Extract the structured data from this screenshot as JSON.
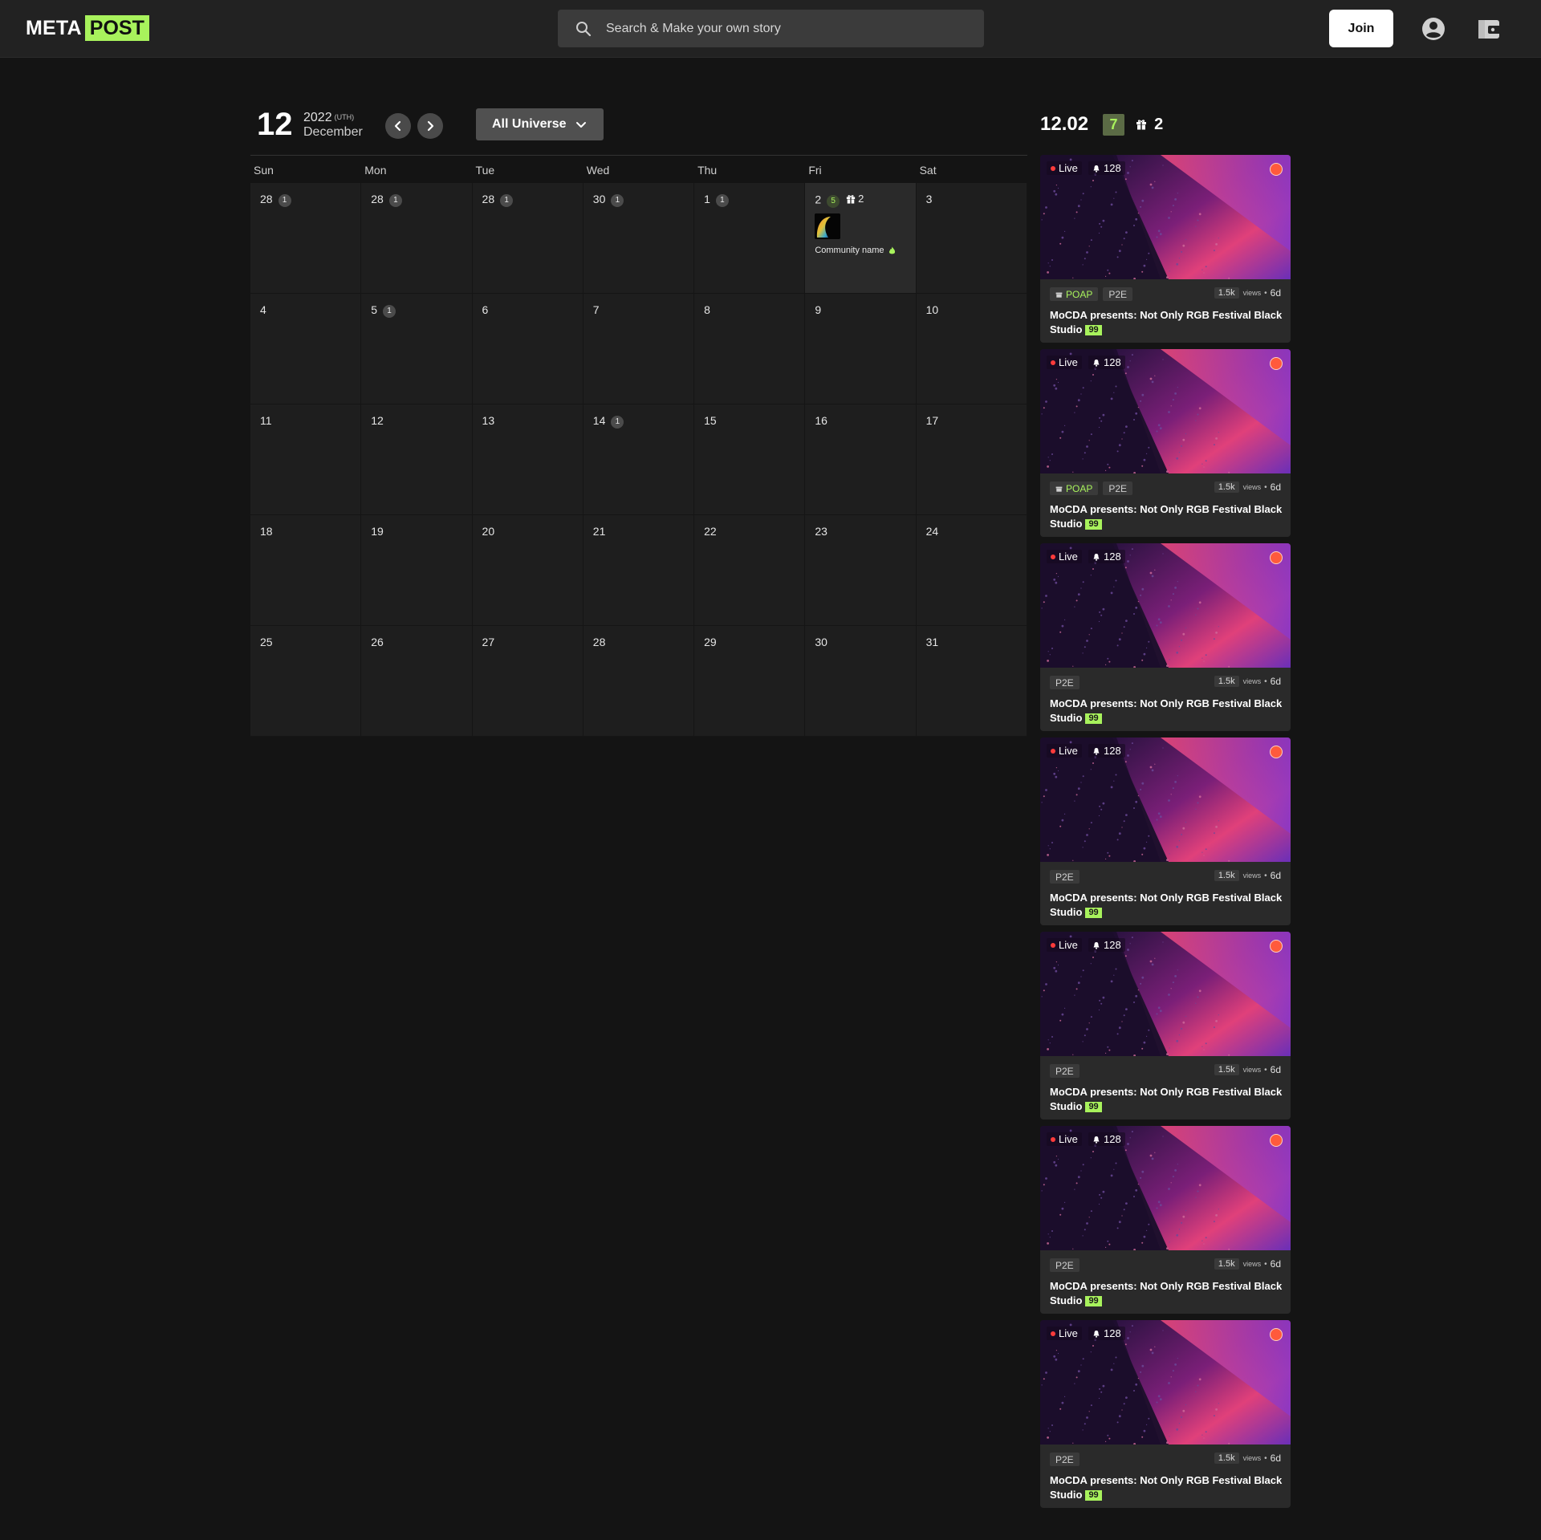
{
  "header": {
    "logo_meta": "META",
    "logo_post": "POST",
    "search_placeholder": "Search & Make your own story",
    "join_label": "Join",
    "icons": {
      "search": "search-icon",
      "account": "account-circle-icon",
      "wallet": "wallet-icon"
    },
    "brand_color": "#a8f25c"
  },
  "calendar": {
    "big_day": "12",
    "year": "2022",
    "timezone": "(UTH)",
    "month": "December",
    "universe_label": "All Universe",
    "weekdays": [
      "Sun",
      "Mon",
      "Tue",
      "Wed",
      "Thu",
      "Fri",
      "Sat"
    ],
    "weeks": [
      [
        {
          "day": "28",
          "count": "1"
        },
        {
          "day": "28",
          "count": "1"
        },
        {
          "day": "28",
          "count": "1"
        },
        {
          "day": "30",
          "count": "1"
        },
        {
          "day": "1",
          "count": "1"
        },
        {
          "day": "2",
          "count": "5",
          "gifts": "2",
          "selected": true,
          "community": "Community name"
        },
        {
          "day": "3"
        }
      ],
      [
        {
          "day": "4"
        },
        {
          "day": "5",
          "count": "1"
        },
        {
          "day": "6"
        },
        {
          "day": "7"
        },
        {
          "day": "8"
        },
        {
          "day": "9"
        },
        {
          "day": "10"
        }
      ],
      [
        {
          "day": "11"
        },
        {
          "day": "12"
        },
        {
          "day": "13"
        },
        {
          "day": "14",
          "count": "1"
        },
        {
          "day": "15"
        },
        {
          "day": "16"
        },
        {
          "day": "17"
        }
      ],
      [
        {
          "day": "18"
        },
        {
          "day": "19"
        },
        {
          "day": "20"
        },
        {
          "day": "21"
        },
        {
          "day": "22"
        },
        {
          "day": "23"
        },
        {
          "day": "24"
        }
      ],
      [
        {
          "day": "25"
        },
        {
          "day": "26"
        },
        {
          "day": "27"
        },
        {
          "day": "28"
        },
        {
          "day": "29"
        },
        {
          "day": "30"
        },
        {
          "day": "31"
        }
      ]
    ]
  },
  "sidebar": {
    "date": "12.02",
    "count": "7",
    "gifts": "2",
    "cards": [
      {
        "live": "Live",
        "watchers": "128",
        "tags": [
          "POAP",
          "P2E"
        ],
        "views": "1.5k",
        "views_label": "views",
        "sep": "•",
        "age": "6d",
        "title": "MoCDA presents: Not Only RGB Festival Black Studio",
        "score": "99"
      },
      {
        "live": "Live",
        "watchers": "128",
        "tags": [
          "POAP",
          "P2E"
        ],
        "views": "1.5k",
        "views_label": "views",
        "sep": "•",
        "age": "6d",
        "title": "MoCDA presents: Not Only RGB Festival Black Studio",
        "score": "99"
      },
      {
        "live": "Live",
        "watchers": "128",
        "tags": [
          "P2E"
        ],
        "views": "1.5k",
        "views_label": "views",
        "sep": "•",
        "age": "6d",
        "title": "MoCDA presents: Not Only RGB Festival Black Studio",
        "score": "99"
      },
      {
        "live": "Live",
        "watchers": "128",
        "tags": [
          "P2E"
        ],
        "views": "1.5k",
        "views_label": "views",
        "sep": "•",
        "age": "6d",
        "title": "MoCDA presents: Not Only RGB Festival Black Studio",
        "score": "99"
      },
      {
        "live": "Live",
        "watchers": "128",
        "tags": [
          "P2E"
        ],
        "views": "1.5k",
        "views_label": "views",
        "sep": "•",
        "age": "6d",
        "title": "MoCDA presents: Not Only RGB Festival Black Studio",
        "score": "99"
      },
      {
        "live": "Live",
        "watchers": "128",
        "tags": [
          "P2E"
        ],
        "views": "1.5k",
        "views_label": "views",
        "sep": "•",
        "age": "6d",
        "title": "MoCDA presents: Not Only RGB Festival Black Studio",
        "score": "99"
      },
      {
        "live": "Live",
        "watchers": "128",
        "tags": [
          "P2E"
        ],
        "views": "1.5k",
        "views_label": "views",
        "sep": "•",
        "age": "6d",
        "title": "MoCDA presents: Not Only RGB Festival Black Studio",
        "score": "99"
      }
    ]
  }
}
